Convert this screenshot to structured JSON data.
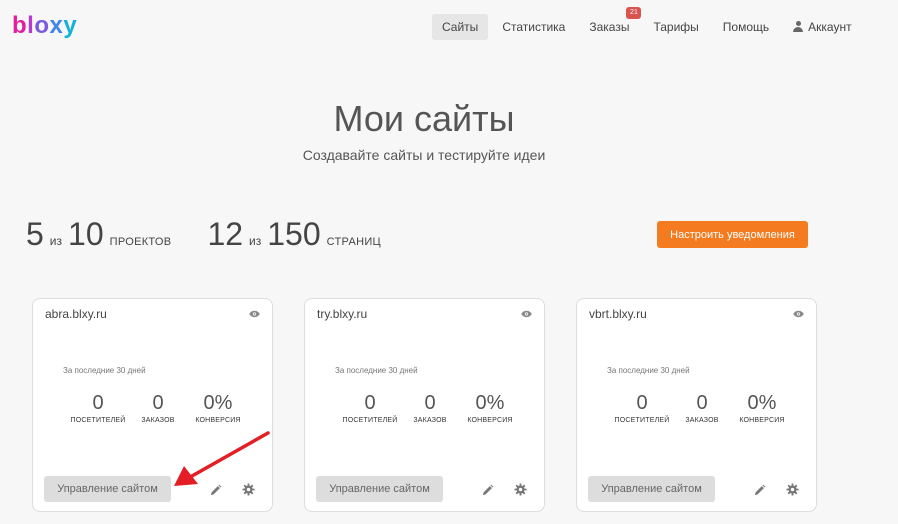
{
  "logo": {
    "letters": [
      "b",
      "l",
      "o",
      "x",
      "y"
    ]
  },
  "nav": {
    "items": [
      {
        "label": "Сайты",
        "active": true
      },
      {
        "label": "Статистика"
      },
      {
        "label": "Заказы",
        "badge": "21"
      },
      {
        "label": "Тарифы"
      },
      {
        "label": "Помощь"
      },
      {
        "label": "Аккаунт",
        "icon": "user-icon"
      }
    ]
  },
  "hero": {
    "title": "Мои сайты",
    "subtitle": "Создавайте сайты и тестируйте идеи"
  },
  "stats": {
    "projects": {
      "used": "5",
      "of": "из",
      "total": "10",
      "unit": "ПРОЕКТОВ"
    },
    "pages": {
      "used": "12",
      "of": "из",
      "total": "150",
      "unit": "СТРАНИЦ"
    }
  },
  "notify_button": "Настроить уведомления",
  "cards": [
    {
      "domain": "abra.blxy.ru",
      "period": "За последние 30 дней",
      "metrics": [
        {
          "value": "0",
          "label": "ПОСЕТИТЕЛЕЙ"
        },
        {
          "value": "0",
          "label": "ЗАКАЗОВ"
        },
        {
          "value": "0%",
          "label": "КОНВЕРСИЯ"
        }
      ],
      "manage_label": "Управление сайтом"
    },
    {
      "domain": "try.blxy.ru",
      "period": "За последние 30 дней",
      "metrics": [
        {
          "value": "0",
          "label": "ПОСЕТИТЕЛЕЙ"
        },
        {
          "value": "0",
          "label": "ЗАКАЗОВ"
        },
        {
          "value": "0%",
          "label": "КОНВЕРСИЯ"
        }
      ],
      "manage_label": "Управление сайтом"
    },
    {
      "domain": "vbrt.blxy.ru",
      "period": "За последние 30 дней",
      "metrics": [
        {
          "value": "0",
          "label": "ПОСЕТИТЕЛЕЙ"
        },
        {
          "value": "0",
          "label": "ЗАКАЗОВ"
        },
        {
          "value": "0%",
          "label": "КОНВЕРСИЯ"
        }
      ],
      "manage_label": "Управление сайтом"
    }
  ],
  "colors": {
    "accent": "#f47b20",
    "badge": "#d9534f",
    "annotation_arrow": "#e31e24"
  }
}
